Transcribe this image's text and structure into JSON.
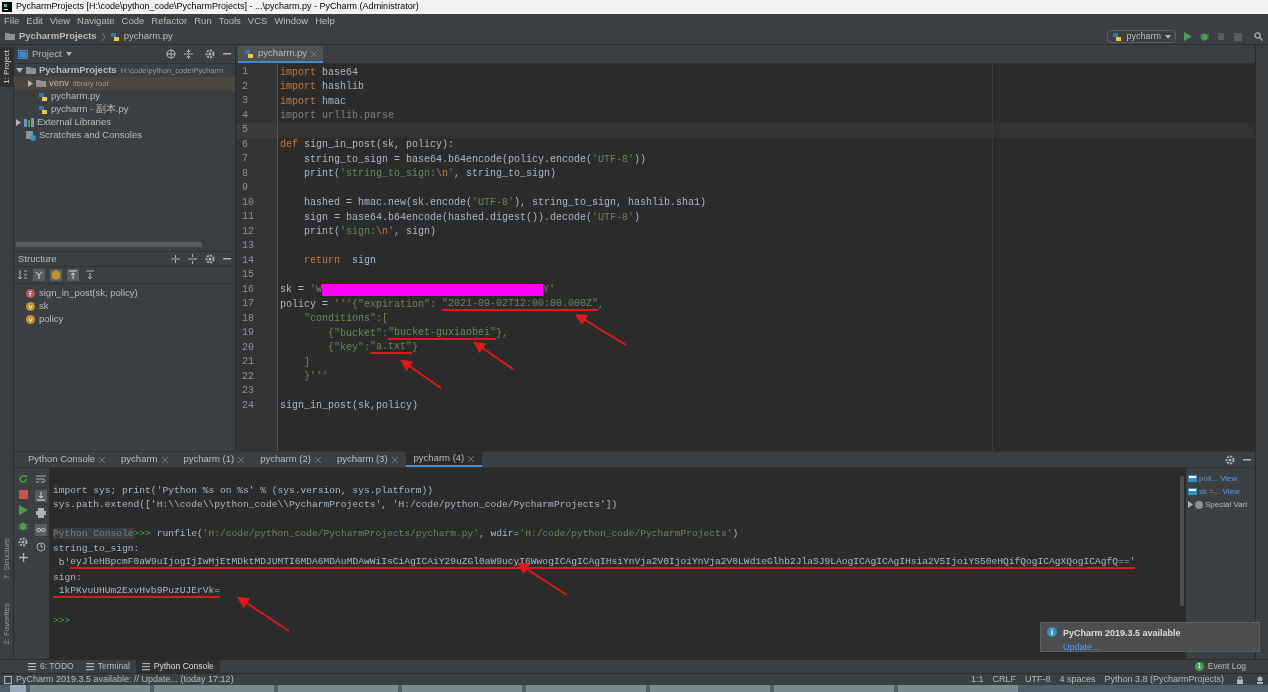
{
  "window": {
    "title": "PycharmProjects [H:\\code\\python_code\\PycharmProjects] - ...\\pycharm.py - PyCharm (Administrator)"
  },
  "menu": [
    "File",
    "Edit",
    "View",
    "Navigate",
    "Code",
    "Refactor",
    "Run",
    "Tools",
    "VCS",
    "Window",
    "Help"
  ],
  "breadcrumbs": [
    "PycharmProjects",
    "pycharm.py"
  ],
  "run_config": "pycharm",
  "side_stripe": [
    {
      "label": "1: Project",
      "selected": true
    },
    {
      "label": "7: Structure",
      "selected": false
    },
    {
      "label": "2: Favorites",
      "selected": false
    }
  ],
  "project_panel": {
    "title": "Project",
    "tree": [
      {
        "label": "PycharmProjects",
        "hint": "H:\\code\\python_code\\Pycharm",
        "kind": "folder",
        "expanded": true,
        "selected": false,
        "children": [
          {
            "label": "venv",
            "hint": "library root",
            "kind": "folder",
            "expanded": false,
            "selected": true
          },
          {
            "label": "pycharm.py",
            "kind": "python",
            "selected": false
          },
          {
            "label": "pycharm - 副本.py",
            "kind": "python",
            "selected": false
          }
        ]
      },
      {
        "label": "External Libraries",
        "kind": "library",
        "expanded": false,
        "selected": false
      },
      {
        "label": "Scratches and Consoles",
        "kind": "scratch",
        "selected": false
      }
    ]
  },
  "structure_panel": {
    "title": "Structure",
    "items": [
      {
        "label": "sign_in_post(sk, policy)",
        "kind": "function"
      },
      {
        "label": "sk",
        "kind": "variable"
      },
      {
        "label": "policy",
        "kind": "variable"
      }
    ]
  },
  "editor": {
    "tabs": [
      {
        "label": "pycharm.py",
        "selected": true
      }
    ],
    "lines": [
      {
        "no": "1",
        "tokens": [
          {
            "kind": "keyword",
            "text": "import"
          },
          {
            "kind": "plain",
            "text": " base64"
          }
        ]
      },
      {
        "no": "2",
        "tokens": [
          {
            "kind": "keyword",
            "text": "import"
          },
          {
            "kind": "plain",
            "text": " hashlib"
          }
        ]
      },
      {
        "no": "3",
        "tokens": [
          {
            "kind": "keyword",
            "text": "import"
          },
          {
            "kind": "plain",
            "text": " hmac"
          }
        ]
      },
      {
        "no": "4",
        "tokens": [
          {
            "kind": "unused",
            "text": "import urllib.parse"
          }
        ]
      },
      {
        "no": "5",
        "current": true
      },
      {
        "no": "6",
        "tokens": [
          {
            "kind": "keyword",
            "text": "def"
          },
          {
            "kind": "plain",
            "text": " sign_in_post(sk, policy):"
          }
        ]
      },
      {
        "no": "7",
        "tokens": [
          {
            "kind": "plain",
            "text": "    string_to_sign = base64.b64encode(policy.encode("
          },
          {
            "kind": "string",
            "text": "'UTF-8'"
          },
          {
            "kind": "plain",
            "text": "))"
          }
        ]
      },
      {
        "no": "8",
        "tokens": [
          {
            "kind": "plain",
            "text": "    print("
          },
          {
            "kind": "string",
            "text": "'string_to_sign:"
          },
          {
            "kind": "escape",
            "text": "\\n"
          },
          {
            "kind": "string",
            "text": "'"
          },
          {
            "kind": "plain",
            "text": ", string_to_sign)"
          }
        ]
      },
      {
        "no": "9"
      },
      {
        "no": "10",
        "tokens": [
          {
            "kind": "plain",
            "text": "    hashed = hmac.new(sk.encode("
          },
          {
            "kind": "string",
            "text": "'UTF-8'"
          },
          {
            "kind": "plain",
            "text": "), string_to_sign, hashlib.sha1)"
          }
        ]
      },
      {
        "no": "11",
        "tokens": [
          {
            "kind": "plain",
            "text": "    sign = base64.b64encode(hashed.digest()).decode("
          },
          {
            "kind": "string",
            "text": "'UTF-8'"
          },
          {
            "kind": "plain",
            "text": ")"
          }
        ]
      },
      {
        "no": "12",
        "tokens": [
          {
            "kind": "plain",
            "text": "    print("
          },
          {
            "kind": "string",
            "text": "'sign:"
          },
          {
            "kind": "escape",
            "text": "\\n"
          },
          {
            "kind": "string",
            "text": "'"
          },
          {
            "kind": "plain",
            "text": ", sign)"
          }
        ]
      },
      {
        "no": "13"
      },
      {
        "no": "14",
        "tokens": [
          {
            "kind": "keyword",
            "text": "    return"
          },
          {
            "kind": "plain",
            "text": "  sign"
          }
        ]
      },
      {
        "no": "15"
      },
      {
        "no": "16",
        "tokens": [
          {
            "kind": "plain",
            "text": "sk = "
          },
          {
            "kind": "string",
            "text": "'W"
          },
          {
            "kind": "redacted"
          },
          {
            "kind": "string",
            "text": "Y'"
          }
        ]
      },
      {
        "no": "17",
        "tokens": [
          {
            "kind": "plain",
            "text": "policy = "
          },
          {
            "kind": "string",
            "text": "'''{\"expiration\": "
          },
          {
            "kind": "underlined_string",
            "text": "\"2021-09-02T12:00:00.000Z\""
          },
          {
            "kind": "string",
            "text": ","
          }
        ]
      },
      {
        "no": "18",
        "tokens": [
          {
            "kind": "string",
            "text": "    \"conditions\":["
          }
        ]
      },
      {
        "no": "19",
        "tokens": [
          {
            "kind": "string",
            "text": "        {\"bucket\":"
          },
          {
            "kind": "underlined_string",
            "text": "\"bucket-guxiaobei\""
          },
          {
            "kind": "string",
            "text": "},"
          }
        ]
      },
      {
        "no": "20",
        "tokens": [
          {
            "kind": "string",
            "text": "        {\"key\":"
          },
          {
            "kind": "underlined_string",
            "text": "\"a.txt\""
          },
          {
            "kind": "string",
            "text": "}"
          }
        ]
      },
      {
        "no": "21",
        "tokens": [
          {
            "kind": "string",
            "text": "    ]"
          }
        ]
      },
      {
        "no": "22",
        "tokens": [
          {
            "kind": "string",
            "text": "    }'''"
          }
        ]
      },
      {
        "no": "23"
      },
      {
        "no": "24",
        "tokens": [
          {
            "kind": "plain",
            "text": "sign_in_post(sk,policy)"
          }
        ]
      }
    ]
  },
  "console": {
    "tabs": [
      {
        "label": "Python Console",
        "selected": false
      },
      {
        "label": "pycharm",
        "selected": false
      },
      {
        "label": "pycharm (1)",
        "selected": false
      },
      {
        "label": "pycharm (2)",
        "selected": false
      },
      {
        "label": "pycharm (3)",
        "selected": false
      },
      {
        "label": "pycharm (4)",
        "selected": true
      }
    ],
    "lines": [
      {
        "tokens": [
          {
            "kind": "plain",
            "text": "import sys; print('Python %s on %s' % (sys.version, sys.platform))"
          }
        ]
      },
      {
        "tokens": [
          {
            "kind": "plain",
            "text": "sys.path.extend(['H:\\\\code\\\\python_code\\\\PycharmProjects', 'H:/code/python_code/PycharmProjects'])"
          }
        ]
      },
      {
        "kind": "blank"
      },
      {
        "tokens": [
          {
            "kind": "label",
            "text": "Python Console"
          },
          {
            "kind": "prompt",
            "text": ">>> "
          },
          {
            "kind": "plain",
            "text": "runfile("
          },
          {
            "kind": "string",
            "text": "'H:/code/python_code/PycharmProjects/pycharm.py'"
          },
          {
            "kind": "plain",
            "text": ", wdir="
          },
          {
            "kind": "string",
            "text": "'H:/code/python_code/PycharmProjects'"
          },
          {
            "kind": "plain",
            "text": ")"
          }
        ]
      },
      {
        "tokens": [
          {
            "kind": "plain",
            "text": "string_to_sign:"
          }
        ]
      },
      {
        "tokens": [
          {
            "kind": "plain",
            "text": " b'"
          },
          {
            "kind": "underlined_plain",
            "text": "eyJleHBpcmF0aW9uIjogIjIwMjEtMDktMDJUMTI6MDA6MDAuMDAwWiIsCiAgICAiY29uZGl0aW9ucyI6WwogICAgICAgIHsiYnVja2V0IjoiYnVja2V0LWd1eGlhb2JlaSJ9LAogICAgICAgIHsia2V5IjoiYS50eHQifQogICAgXQogICAgfQ=='"
          }
        ]
      },
      {
        "tokens": [
          {
            "kind": "plain",
            "text": "sign:"
          }
        ]
      },
      {
        "tokens": [
          {
            "kind": "underlined_plain",
            "text": " 1kPKvuUHUm2ExvHvb9PuzUJErVk="
          }
        ]
      },
      {
        "kind": "blank"
      },
      {
        "tokens": [
          {
            "kind": "prompt",
            "text": ">>>"
          }
        ]
      }
    ],
    "variables": [
      {
        "name": "poli...",
        "action": "View",
        "kind": "variable"
      },
      {
        "name": "sk =...",
        "action": "View",
        "kind": "variable"
      },
      {
        "name": "Special Vari",
        "kind": "group"
      }
    ]
  },
  "notification": {
    "title": "PyCharm 2019.3.5 available",
    "link": "Update..."
  },
  "bottom_tabs": [
    {
      "label": "6: TODO",
      "selected": false
    },
    {
      "label": "Terminal",
      "selected": false
    },
    {
      "label": "Python Console",
      "selected": true
    }
  ],
  "event_log": {
    "label": "Event Log",
    "count": "1"
  },
  "status_bar": {
    "message": "PyCharm 2019.3.5 available: // Update... (today 17:12)",
    "items": [
      "1:1",
      "CRLF",
      "UTF-8",
      "4 spaces",
      "Python 3.8 (PycharmProjects)"
    ]
  }
}
